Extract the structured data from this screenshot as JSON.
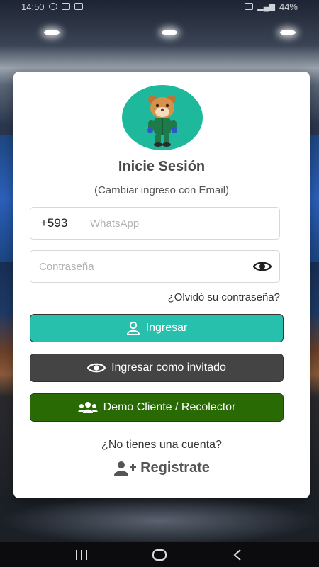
{
  "status_bar": {
    "time": "14:50",
    "battery": "44%"
  },
  "login": {
    "title": "Inicie Sesión",
    "subtitle": "(Cambiar ingreso con Email)",
    "phone_prefix": "+593",
    "phone_placeholder": "WhatsApp",
    "password_placeholder": "Contraseña",
    "forgot_password": "¿Olvidó su contraseña?",
    "login_button": "Ingresar",
    "guest_button": "Ingresar como invitado",
    "demo_button": "Demo Cliente / Recolector",
    "no_account": "¿No tienes una cuenta?",
    "register": "Registrate"
  },
  "colors": {
    "avatar_bg": "#1eb89c",
    "login_button": "#26c0ad",
    "guest_button": "#444444",
    "demo_button": "#2a6a05"
  },
  "icons": {
    "avatar": "hamster-mascot",
    "password_toggle": "eye-icon",
    "login": "user-icon",
    "guest": "eye-icon",
    "demo": "users-icon",
    "register": "user-plus-icon"
  }
}
